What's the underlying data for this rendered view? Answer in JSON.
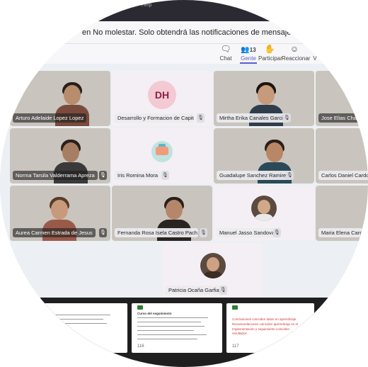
{
  "topbar": {
    "tag": "Help"
  },
  "notice": {
    "text": "en No molestar. Solo obtendrá las notificaciones de mensajes urgentes y las de su"
  },
  "toolbar": {
    "items": [
      {
        "label": "Chat",
        "icon": "chat-icon",
        "glyph": "🗨"
      },
      {
        "label": "Gente",
        "icon": "people-icon",
        "glyph": "👥",
        "badge": "13",
        "active": true
      },
      {
        "label": "Participar",
        "icon": "raise-hand-icon",
        "glyph": "✋"
      },
      {
        "label": "Reaccionar",
        "icon": "smile-icon",
        "glyph": "☺"
      },
      {
        "label": "V",
        "icon": "view-icon",
        "glyph": ""
      }
    ]
  },
  "participants": [
    {
      "name": "Arturo Adelaide Lopez Lopez",
      "type": "video"
    },
    {
      "name": "Desarrollo y Formacion de Capital...",
      "type": "initials",
      "initials": "DH"
    },
    {
      "name": "Mirtha Erika Canales Garcia",
      "type": "video"
    },
    {
      "name": "Jose Elias Chave",
      "type": "video"
    },
    {
      "name": "Norma Tarsila Valderrama Apreza",
      "type": "video"
    },
    {
      "name": "Iris Romina Mora",
      "type": "avatar-image"
    },
    {
      "name": "Guadalupe Sanchez Ramirez",
      "type": "video"
    },
    {
      "name": "Carlos Daniel Cardoso",
      "type": "video"
    },
    {
      "name": "Aurea Carmen Estrada de Jesus",
      "type": "video"
    },
    {
      "name": "Fernanda Rosa Isela Castro Pach...",
      "type": "video"
    },
    {
      "name": "Manuel Jasso Sandoval",
      "type": "avatar-photo"
    },
    {
      "name": "Maria Elena Carden",
      "type": "video"
    },
    {
      "name": "Patricia Ocaña Garfias",
      "type": "avatar-photo"
    }
  ],
  "slides": {
    "numbers": [
      "116",
      "117"
    ],
    "s2_title": "Curso del seguimiento",
    "s3_lines": [
      "Conclusiones coinciden datos en aprendizaje",
      "Recomendaciones coinciden aprendizaje en el",
      "Implementación y seguimiento coinciden",
      "resultados"
    ]
  },
  "colors": {
    "accent": "#5b5fc7",
    "dark_bg": "#1f1f1f",
    "grid_bg": "#eceff3"
  }
}
